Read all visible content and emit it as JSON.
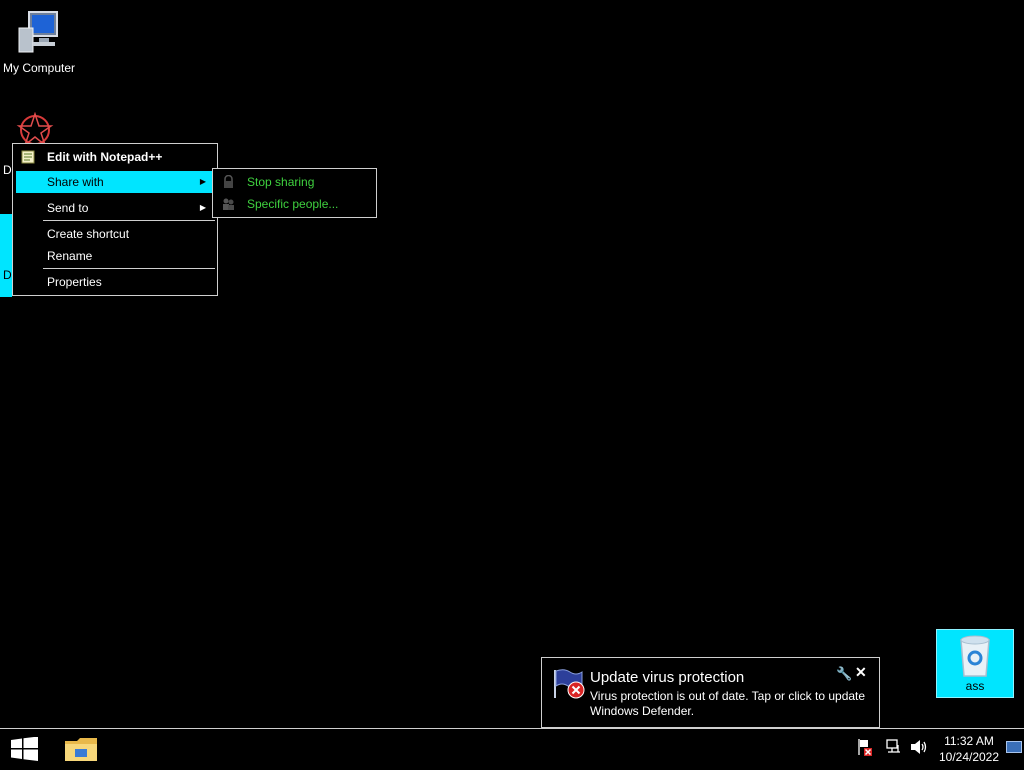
{
  "desktop": {
    "icons": [
      {
        "label": "My Computer",
        "icon": "computer-icon"
      },
      {
        "label": "D",
        "icon": "app-icon"
      },
      {
        "label": "D",
        "icon": "file-icon"
      },
      {
        "label": "ass",
        "icon": "recycle-bin-icon"
      }
    ]
  },
  "context_menu": {
    "items": [
      {
        "label": "Edit with Notepad++",
        "icon": "notepad-plus-plus-icon",
        "bold": true
      },
      {
        "label": "Share with",
        "submenu": true,
        "highlighted": true
      },
      {
        "label": "Send to",
        "submenu": true
      },
      {
        "label": "Create shortcut"
      },
      {
        "label": "Rename"
      },
      {
        "label": "Properties"
      }
    ],
    "submenu": {
      "items": [
        {
          "label": "Stop sharing",
          "icon": "lock-icon"
        },
        {
          "label": "Specific people...",
          "icon": "people-icon"
        }
      ]
    }
  },
  "notification": {
    "title": "Update virus protection",
    "body": "Virus protection is out of date. Tap or click to update Windows Defender.",
    "icon": "defender-flag-error-icon"
  },
  "taskbar": {
    "time": "11:32 AM",
    "date": "10/24/2022",
    "pinned": [
      "file-explorer-icon"
    ],
    "tray": [
      "action-center-error-icon",
      "network-icon",
      "volume-icon",
      "show-desktop-icon"
    ]
  },
  "colors": {
    "highlight": "#00e5ff",
    "submenu_text": "#3fd13f",
    "border": "#cfcfcf"
  }
}
